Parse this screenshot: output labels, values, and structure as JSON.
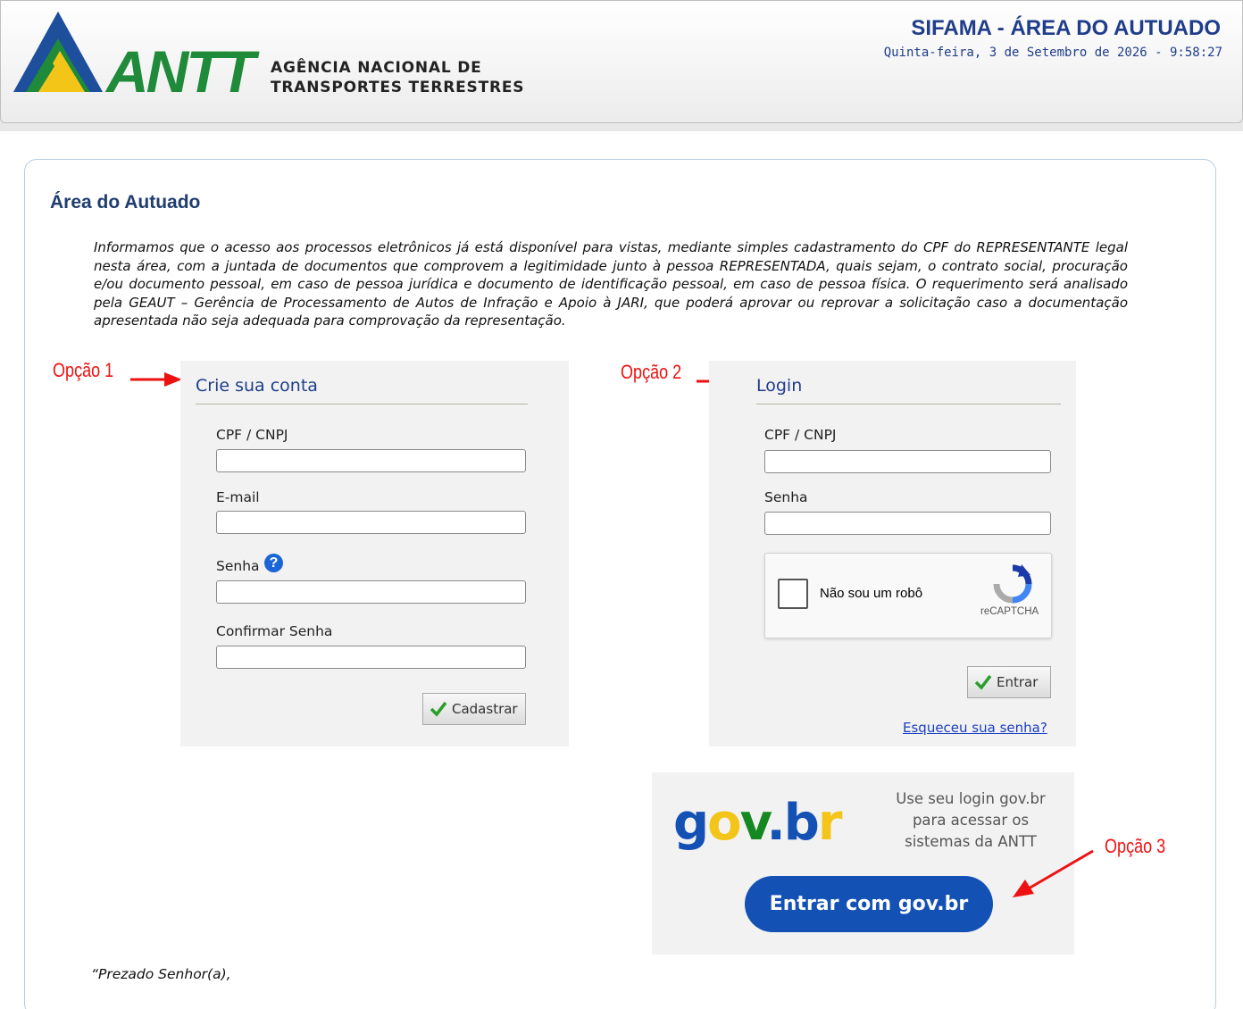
{
  "header": {
    "logo_text": "ANTT",
    "agency_line1": "AGÊNCIA NACIONAL DE",
    "agency_line2": "TRANSPORTES TERRESTRES",
    "system_title": "SIFAMA - ÁREA DO AUTUADO",
    "datetime": "Quinta-feira, 3 de Setembro de 2026 - 9:58:27"
  },
  "main": {
    "title": "Área do Autuado",
    "notice": "Informamos que o acesso aos processos eletrônicos já está disponível para vistas, mediante simples cadastramento do CPF do REPRESENTANTE legal nesta área, com a juntada de documentos que comprovem a legitimidade junto à pessoa REPRESENTADA, quais sejam, o contrato social, procuração e/ou documento pessoal, em caso de pessoa jurídica e documento de identificação pessoal, em caso de pessoa física. O requerimento será analisado pela GEAUT – Gerência de Processamento de Autos de Infração e Apoio à JARI, que poderá aprovar ou reprovar a solicitação caso a documentação apresentada não seja adequada para comprovação da representação.",
    "salutation": "“Prezado Senhor(a),"
  },
  "annotations": {
    "option1": "Opção 1",
    "option2": "Opção 2",
    "option3": "Opção 3",
    "color": "#e11111"
  },
  "register": {
    "title": "Crie sua conta",
    "cpf_label": "CPF / CNPJ",
    "cpf_value": "",
    "email_label": "E-mail",
    "email_value": "",
    "password_label": "Senha",
    "password_value": "",
    "confirm_label": "Confirmar Senha",
    "confirm_value": "",
    "help_icon": "?",
    "submit_label": "Cadastrar"
  },
  "login": {
    "title": "Login",
    "cpf_label": "CPF / CNPJ",
    "cpf_value": "",
    "password_label": "Senha",
    "password_value": "",
    "captcha_text": "Não sou um robô",
    "captcha_brand": "reCAPTCHA",
    "submit_label": "Entrar",
    "forgot_link": "Esqueceu sua senha?"
  },
  "govbr": {
    "logo_g": "g",
    "logo_o": "o",
    "logo_v": "v",
    "logo_dot": ".",
    "logo_b": "b",
    "logo_r": "r",
    "description": "Use seu login gov.br para acessar os sistemas da ANTT",
    "button_label": "Entrar com gov.br",
    "button_color": "#1351b4"
  },
  "colors": {
    "title_blue": "#1f3d8a",
    "antt_green": "#1f8a3a",
    "antt_blue": "#1d4f9c",
    "antt_yellow": "#f4c519",
    "check_green": "#2a9d2a"
  }
}
